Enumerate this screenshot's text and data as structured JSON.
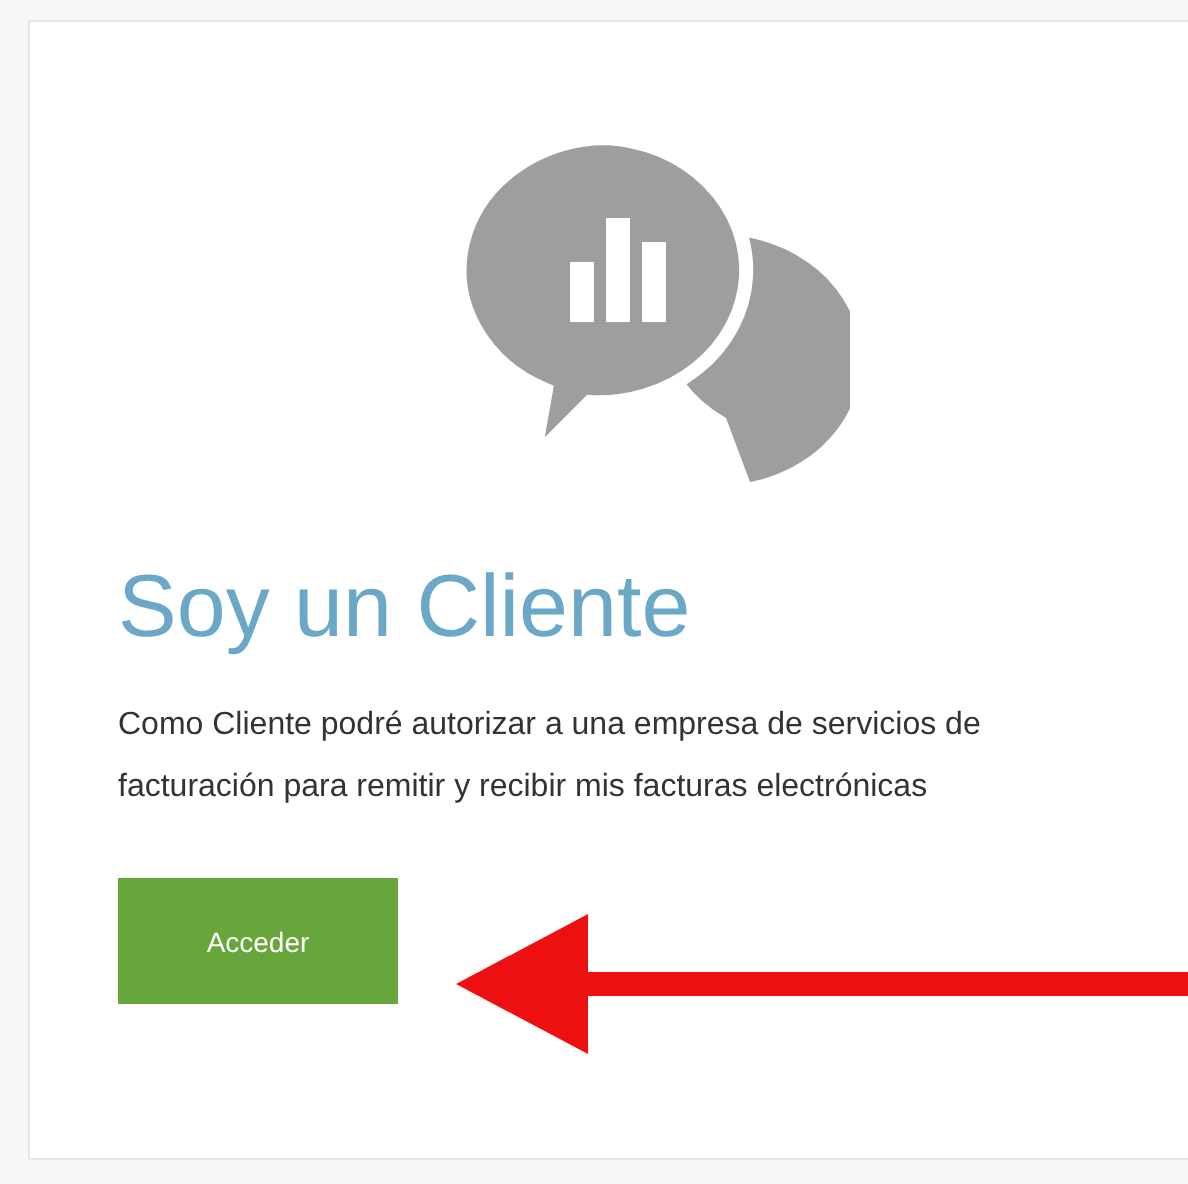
{
  "title": "Soy un Cliente",
  "description": "Como Cliente podré autorizar a una empresa de servicios de facturación para remitir y recibir mis facturas electrónicas",
  "button": {
    "label": "Acceder"
  }
}
